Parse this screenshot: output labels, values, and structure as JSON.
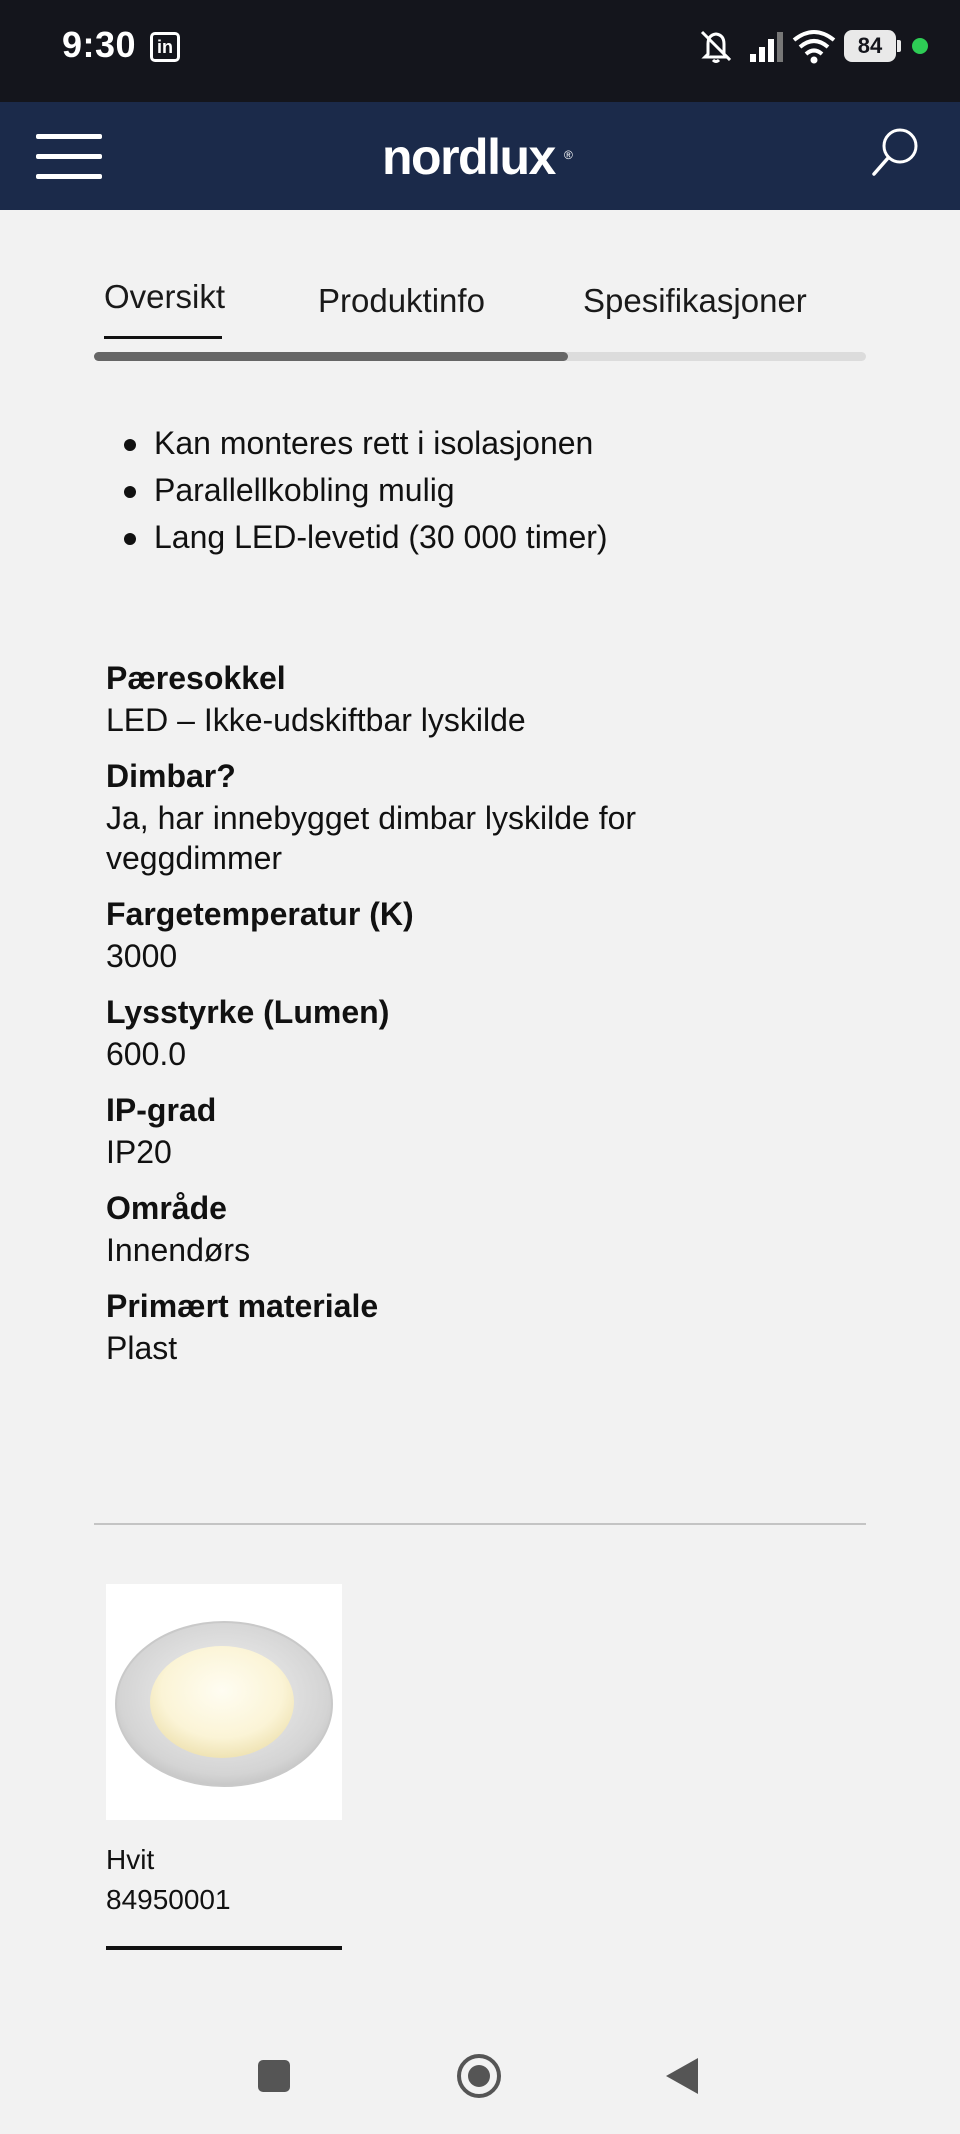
{
  "status_bar": {
    "time": "9:30",
    "app_icon_letter": "in",
    "battery": "84",
    "icons": [
      "linkedin-icon",
      "mute-icon",
      "signal-icon",
      "wifi-icon",
      "battery-icon"
    ]
  },
  "header": {
    "logo": "nordlux",
    "logo_mark": "®",
    "menu_icon": "hamburger-menu-icon",
    "search_icon": "search-icon",
    "colors": {
      "background": "#1b2a4a",
      "text": "#ffffff"
    }
  },
  "tabs": [
    {
      "label": "Oversikt",
      "active": true
    },
    {
      "label": "Produktinfo",
      "active": false
    },
    {
      "label": "Spesifikasjoner",
      "active": false
    }
  ],
  "features": [
    "Kan monteres rett i isolasjonen",
    "Parallellkobling mulig",
    "Lang LED-levetid (30 000 timer)"
  ],
  "specs": [
    {
      "label": "Pæresokkel",
      "value": "LED – Ikke-udskiftbar lyskilde"
    },
    {
      "label": "Dimbar?",
      "value": "Ja, har innebygget dimbar lyskilde for veggdimmer"
    },
    {
      "label": "Fargetemperatur (K)",
      "value": "3000"
    },
    {
      "label": "Lysstyrke (Lumen)",
      "value": "600.0"
    },
    {
      "label": "IP-grad",
      "value": "IP20"
    },
    {
      "label": "Område",
      "value": "Innendørs"
    },
    {
      "label": "Primært materiale",
      "value": "Plast"
    }
  ],
  "variant": {
    "color": "Hvit",
    "sku": "84950001"
  },
  "system_nav": {
    "icons": [
      "recents-icon",
      "home-icon",
      "back-icon"
    ]
  }
}
